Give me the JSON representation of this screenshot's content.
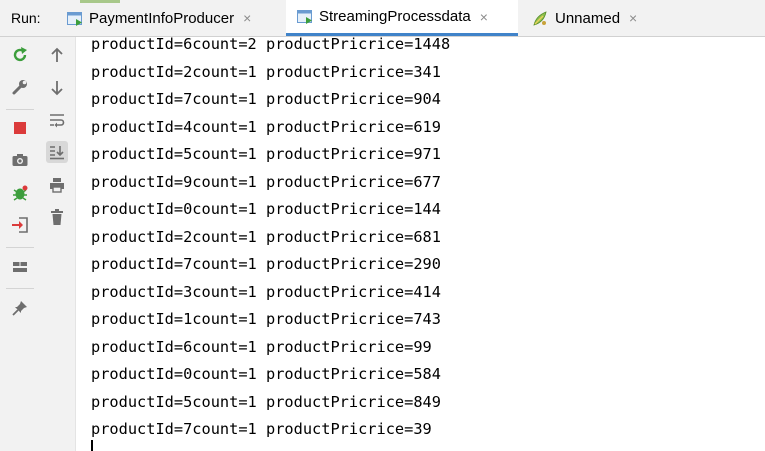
{
  "header": {
    "run_label": "Run:",
    "tabs": [
      {
        "label": "PaymentInfoProducer",
        "icon": "run-config-icon",
        "active": false
      },
      {
        "label": "StreamingProcessdata",
        "icon": "run-config-icon",
        "active": true
      },
      {
        "label": "Unnamed",
        "icon": "spring-icon",
        "active": false
      }
    ],
    "close_glyph": "×"
  },
  "toolbar_left": [
    "rerun-icon",
    "wrench-icon",
    "stop-icon",
    "camera-icon",
    "debug-icon",
    "login-icon",
    "layout-icon",
    "pin-icon"
  ],
  "toolbar_right": [
    "arrow-up-icon",
    "arrow-down-icon",
    "soft-wrap-icon",
    "scroll-to-end-icon",
    "print-icon",
    "trash-icon"
  ],
  "colors": {
    "accent": "#4083c9",
    "rerun": "#3c9e3c",
    "stop": "#db3b3b",
    "toolbar_bg": "#f2f2f2",
    "icon_gray": "#6e6e6e"
  },
  "console": {
    "lines": [
      "productId=6count=2 productPricrice=1448",
      "productId=2count=1 productPricrice=341",
      "productId=7count=1 productPricrice=904",
      "productId=4count=1 productPricrice=619",
      "productId=5count=1 productPricrice=971",
      "productId=9count=1 productPricrice=677",
      "productId=0count=1 productPricrice=144",
      "productId=2count=1 productPricrice=681",
      "productId=7count=1 productPricrice=290",
      "productId=3count=1 productPricrice=414",
      "productId=1count=1 productPricrice=743",
      "productId=6count=1 productPricrice=99",
      "productId=0count=1 productPricrice=584",
      "productId=5count=1 productPricrice=849",
      "productId=7count=1 productPricrice=39"
    ]
  }
}
